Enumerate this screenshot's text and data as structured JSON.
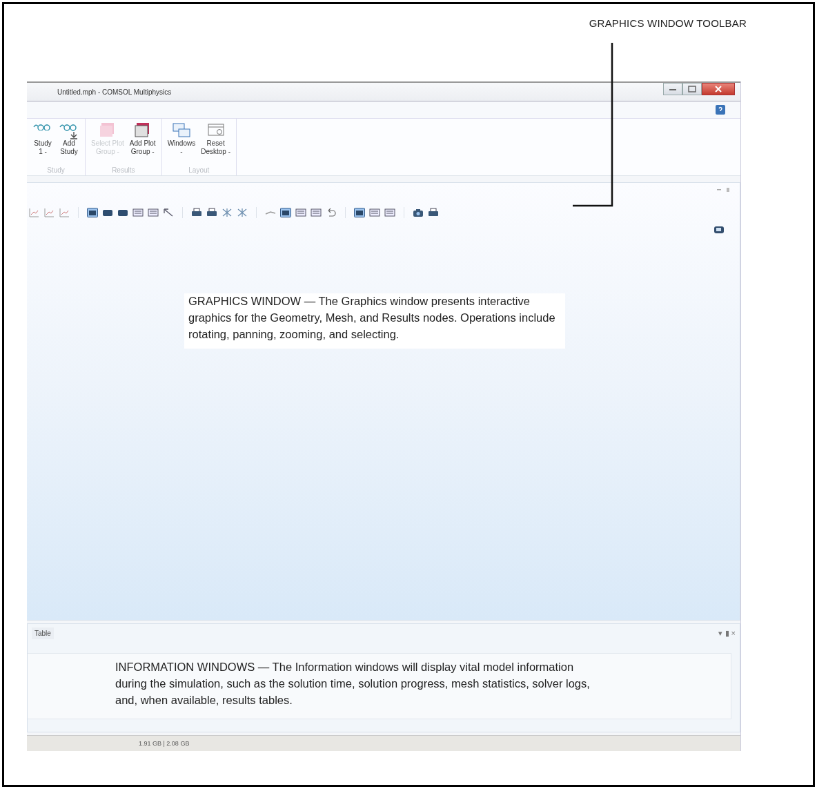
{
  "callout_label": "GRAPHICS WINDOW TOOLBAR",
  "window": {
    "title": "Untitled.mph - COMSOL Multiphysics"
  },
  "ribbon": {
    "groups": [
      {
        "name": "Study",
        "buttons": [
          {
            "kind": "study",
            "lines": [
              "Study",
              "1 -"
            ],
            "disabled": false
          },
          {
            "kind": "add-study",
            "lines": [
              "Add",
              "Study"
            ],
            "disabled": false
          }
        ]
      },
      {
        "name": "Results",
        "buttons": [
          {
            "kind": "plot-group",
            "lines": [
              "Select Plot",
              "Group -"
            ],
            "disabled": true
          },
          {
            "kind": "add-plot-group",
            "lines": [
              "Add Plot",
              "Group -"
            ],
            "disabled": false
          }
        ]
      },
      {
        "name": "Layout",
        "buttons": [
          {
            "kind": "windows",
            "lines": [
              "Windows",
              "-"
            ],
            "disabled": false
          },
          {
            "kind": "reset",
            "lines": [
              "Reset",
              "Desktop -"
            ],
            "disabled": false
          }
        ]
      }
    ]
  },
  "graphics": {
    "callout": "GRAPHICS WINDOW — The Graphics window presents interactive graphics for the Geometry, Mesh, and Results nodes. Operations include rotating, panning, zooming, and selecting."
  },
  "table_panel": {
    "tab": "Table",
    "controls": "▾ ▮ ×",
    "callout": "INFORMATION WINDOWS — The Information windows will display vital model information during the simulation, such as the solution time, solution progress, mesh statistics, solver logs, and, when available, results tables."
  },
  "status_bar": {
    "memory": "1.91 GB | 2.08 GB"
  }
}
